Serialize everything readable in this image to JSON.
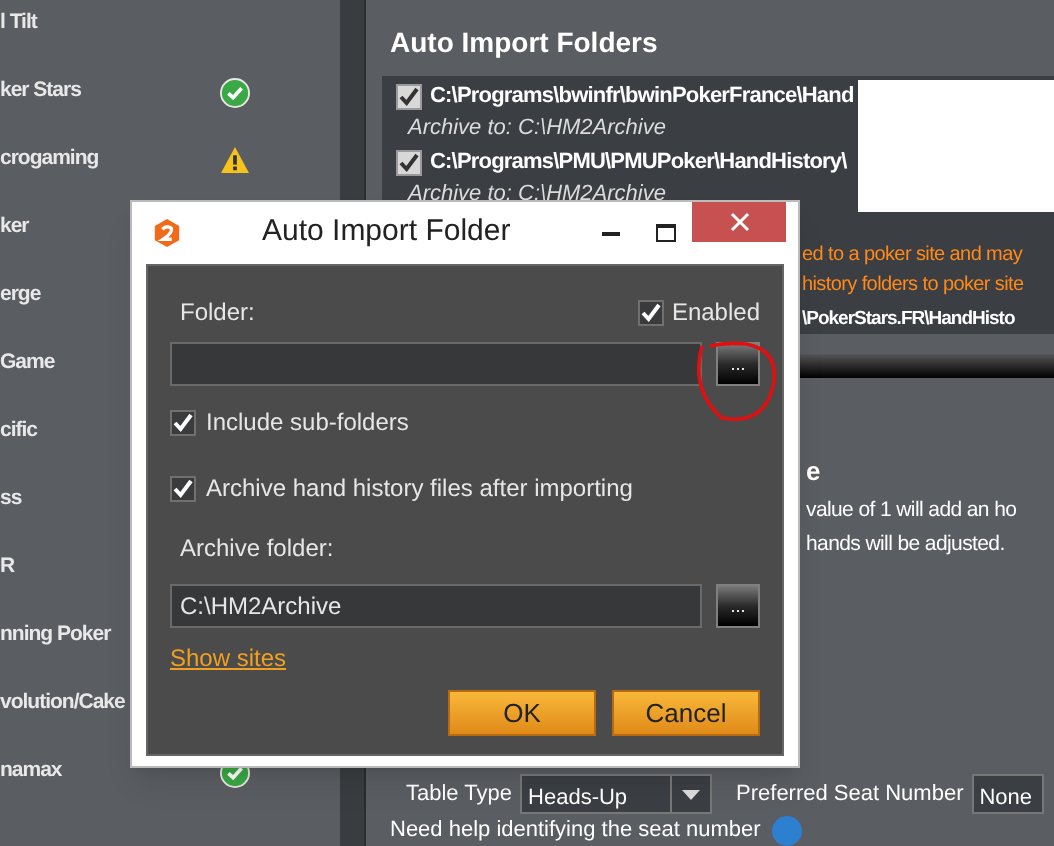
{
  "sidebar": {
    "items": [
      {
        "label": "l Tilt",
        "kind": "plain"
      },
      {
        "label": "ker Stars",
        "kind": "ok"
      },
      {
        "label": "crogaming",
        "kind": "warning"
      },
      {
        "label": "ker",
        "kind": "plain"
      },
      {
        "label": "erge",
        "kind": "plain"
      },
      {
        "label": "Game",
        "kind": "plain"
      },
      {
        "label": "cific",
        "kind": "plain"
      },
      {
        "label": "ss",
        "kind": "plain"
      },
      {
        "label": "R",
        "kind": "plain"
      },
      {
        "label": "nning Poker",
        "kind": "plain"
      },
      {
        "label": "volution/Cake",
        "kind": "plain"
      },
      {
        "label": "namax",
        "kind": "ok"
      }
    ]
  },
  "import_folders": {
    "title": "Auto Import Folders",
    "folders": [
      {
        "path": "C:\\Programs\\bwinfr\\bwinPokerFrance\\Hand",
        "enabled": true,
        "archive": "Archive to: C:\\HM2Archive"
      },
      {
        "path": "C:\\Programs\\PMU\\PMUPoker\\HandHistory\\",
        "enabled": true,
        "archive": "Archive to: C:\\HM2Archive"
      }
    ],
    "notice_lines": [
      "ed to a poker site and may",
      "history folders to poker site"
    ],
    "folder_fragment": "\\PokerStars.FR\\HandHisto"
  },
  "section_2": {
    "title_fragment": "e",
    "text_lines": [
      "value of 1 will add an ho",
      "hands will be adjusted."
    ]
  },
  "seat": {
    "table_type_label": "Table Type",
    "table_type_value": "Heads-Up",
    "preferred_seat_label": "Preferred Seat Number",
    "preferred_seat_value": "None",
    "help_text": "Need help identifying the seat number"
  },
  "dialog": {
    "title": "Auto Import Folder",
    "folder_label": "Folder:",
    "enabled": {
      "label": "Enabled",
      "checked": true
    },
    "browse_label": "...",
    "options": [
      {
        "label": "Include sub-folders",
        "checked": true
      },
      {
        "label": "Archive hand history files after importing",
        "checked": true
      }
    ],
    "archive_label": "Archive folder:",
    "archive_value": "C:\\HM2Archive",
    "archive_browse_label": "...",
    "link": "Show sites",
    "buttons": [
      "OK",
      "Cancel"
    ]
  }
}
